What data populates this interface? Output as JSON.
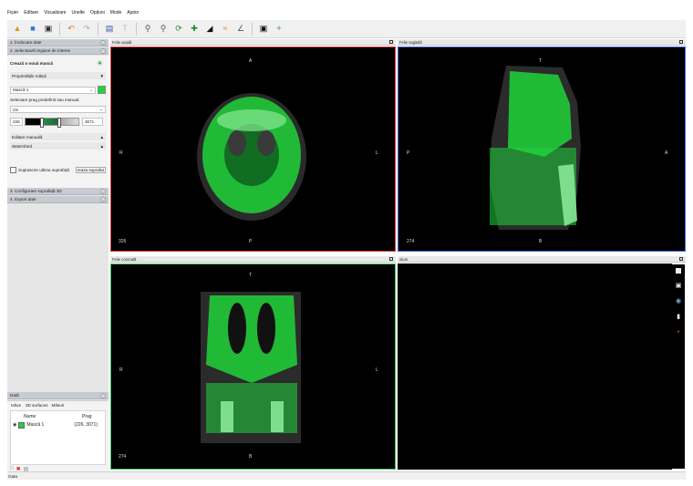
{
  "menu": [
    "Fișier",
    "Editare",
    "Vizualizare",
    "Unelte",
    "Opțiuni",
    "Mode",
    "Ajutor"
  ],
  "left": {
    "sections": {
      "import": "1. Încărcare date",
      "select_roi": "2. Selectează regiune de interes",
      "surface": "3. Configurare suprafață 3D",
      "export": "4. Export date"
    },
    "mask": {
      "create_label": "Crează o nouă mască",
      "properties_label": "Proprietățile măștii",
      "mask_name": "Mască 1",
      "threshold_label": "Selectare prag predefinit sau manual:",
      "preset": "Os",
      "min": "226",
      "max": "3071",
      "manual_edit": "Editare manuală",
      "watershed": "Watershed",
      "overwrite_label": "Suprascrie ultima suprafață",
      "create_surface_button": "reaza suprafat"
    },
    "data": {
      "title": "Dată",
      "tabs": [
        "Măști",
        "3D surfaces",
        "Măsuri"
      ],
      "col_name": "Nume",
      "col_threshold": "Prag",
      "row_name": "Mască 1",
      "row_threshold": "(226, 3071)"
    }
  },
  "views": {
    "axial": {
      "title": "Felie axială",
      "top": "A",
      "bottom": "P",
      "left": "R",
      "right": "L",
      "slice": "326"
    },
    "sagittal": {
      "title": "Felie sagitală",
      "top": "T",
      "bottom": "B",
      "left": "P",
      "right": "A",
      "slice": "274"
    },
    "coronal": {
      "title": "Felie coronală",
      "top": "T",
      "bottom": "B",
      "left": "R",
      "right": "L",
      "slice": "274"
    },
    "volume": {
      "title": "olum"
    }
  },
  "status": "Gata",
  "colors": {
    "mask_green": "#1fd43a",
    "axial_border": "#e04040",
    "sagittal_border": "#4a6ad8",
    "coronal_border": "#40c060"
  }
}
